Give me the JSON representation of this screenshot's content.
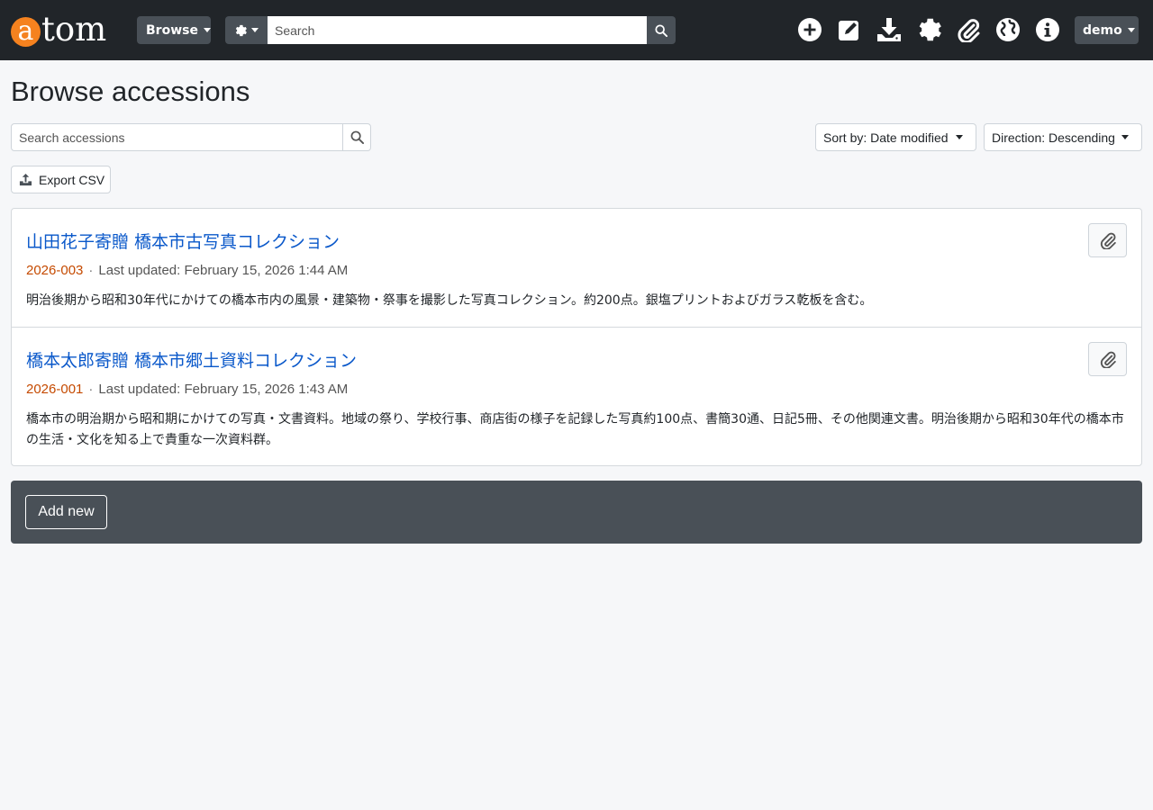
{
  "brand": {
    "logo_a": "a",
    "logo_rest": "tom",
    "accent": "#f5821f"
  },
  "header": {
    "browse_label": "Browse",
    "search": {
      "placeholder": "Search"
    },
    "nav_icons": [
      "plus-circle-icon",
      "edit-icon",
      "download-icon",
      "gear-icon",
      "paperclip-icon",
      "globe-icon",
      "info-icon"
    ],
    "user_label": "demo"
  },
  "page": {
    "title": "Browse accessions",
    "search": {
      "placeholder": "Search accessions"
    },
    "sort_label": "Sort by: Date modified",
    "direction_label": "Direction: Descending",
    "export_label": "Export CSV"
  },
  "results": [
    {
      "title": "山田花子寄贈 橋本市古写真コレクション",
      "identifier": "2026-003",
      "separator": "·",
      "updated": "Last updated: February 15, 2026 1:44 AM",
      "description": "明治後期から昭和30年代にかけての橋本市内の風景・建築物・祭事を撮影した写真コレクション。約200点。銀塩プリントおよびガラス乾板を含む。"
    },
    {
      "title": "橋本太郎寄贈 橋本市郷土資料コレクション",
      "identifier": "2026-001",
      "separator": "·",
      "updated": "Last updated: February 15, 2026 1:43 AM",
      "description": "橋本市の明治期から昭和期にかけての写真・文書資料。地域の祭り、学校行事、商店街の様子を記録した写真約100点、書簡30通、日記5冊、その他関連文書。明治後期から昭和30年代の橋本市の生活・文化を知る上で貴重な一次資料群。"
    }
  ],
  "actions": {
    "add_label": "Add new"
  }
}
